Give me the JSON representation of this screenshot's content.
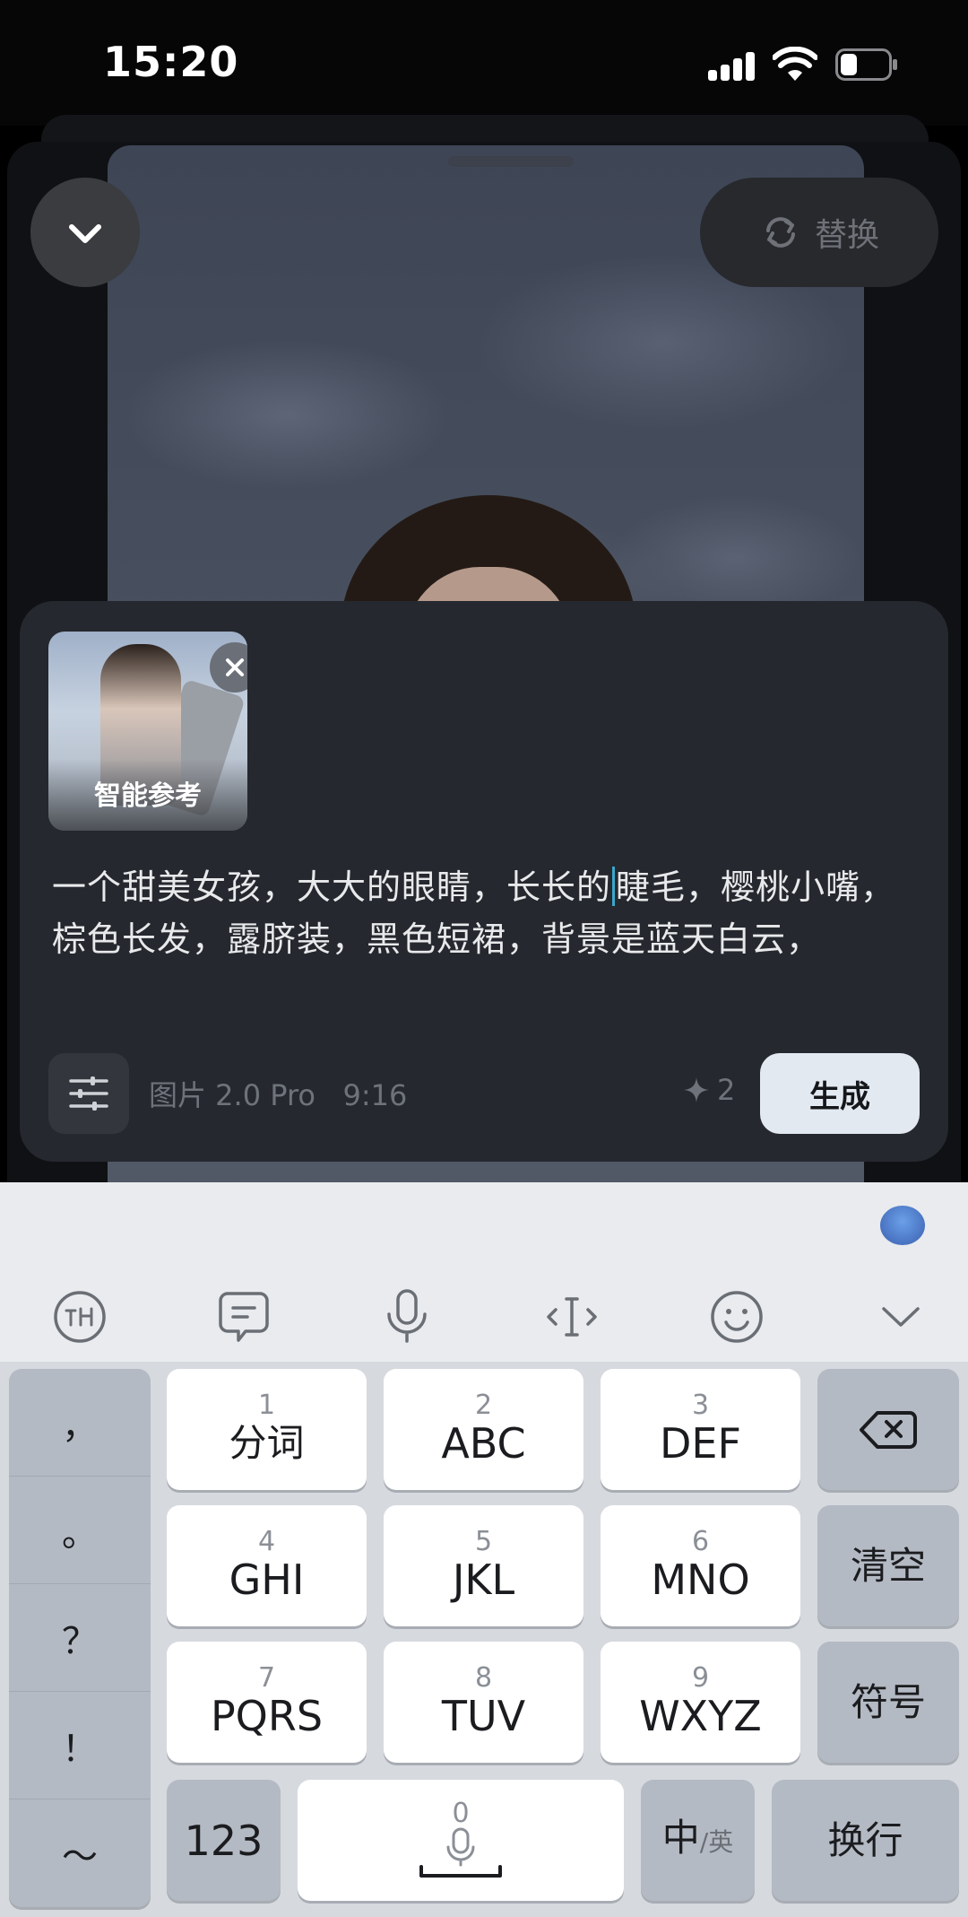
{
  "status_bar": {
    "time": "15:20"
  },
  "header": {
    "replace_label": "替换"
  },
  "reference": {
    "label": "智能参考"
  },
  "prompt": {
    "before_caret": "一个甜美女孩，大大的眼睛，长长的",
    "after_caret": "睫毛，樱桃小嘴，棕色长发，露脐装，黑色短裙，背景是蓝天白云，"
  },
  "controls": {
    "model": "图片 2.0 Pro",
    "ratio": "9:16",
    "credits": "2",
    "generate_label": "生成"
  },
  "keyboard": {
    "punctuation": [
      "，",
      "。",
      "？",
      "！",
      "～"
    ],
    "rows": [
      [
        {
          "num": "1",
          "label": "分词"
        },
        {
          "num": "2",
          "label": "ABC"
        },
        {
          "num": "3",
          "label": "DEF"
        }
      ],
      [
        {
          "num": "4",
          "label": "GHI"
        },
        {
          "num": "5",
          "label": "JKL"
        },
        {
          "num": "6",
          "label": "MNO"
        }
      ],
      [
        {
          "num": "7",
          "label": "PQRS"
        },
        {
          "num": "8",
          "label": "TUV"
        },
        {
          "num": "9",
          "label": "WXYZ"
        }
      ]
    ],
    "clear_label": "清空",
    "symbols_label": "符号",
    "num_label": "123",
    "space_num": "0",
    "lang_main": "中",
    "lang_sub": "/英",
    "enter_label": "换行",
    "toolbar_icons": [
      "ifly-logo-icon",
      "chat-bubble-icon",
      "microphone-icon",
      "cursor-move-icon",
      "emoji-icon",
      "chevron-down-icon"
    ]
  },
  "colors": {
    "accent_caret": "#3aa7c9",
    "panel_bg": "#25282e",
    "generate_bg": "#e3e9f1"
  }
}
